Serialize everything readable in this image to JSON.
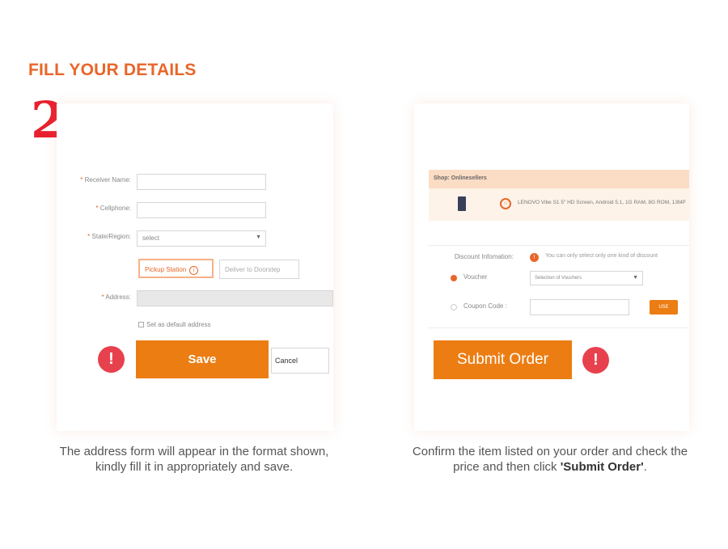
{
  "heading": "FILL YOUR DETAILS",
  "step_number": "2",
  "address_form": {
    "receiver_label": "Receiver Name:",
    "cellphone_label": "Cellphone:",
    "state_label": "State/Region:",
    "state_value": "select",
    "pickup_label": "Pickup Station",
    "pickup_info_icon": "i",
    "deliver_label": "Deliver to Doorstep",
    "address_label": "Address:",
    "default_checkbox_label": "Set as default address",
    "save_label": "Save",
    "cancel_label": "Cancel",
    "alert_symbol": "!"
  },
  "order": {
    "shop_label": "Shop: Onlinesellers",
    "item_icon": "○",
    "item_text": "LENOVO Vibe S1 5\" HD Screen, Android 5.1, 1G RAM, 8G ROM, 13MP",
    "discount_label": "Discount Infomation:",
    "discount_info_icon": "!",
    "discount_note": "You can only select only one kind of discount",
    "voucher_label": "Voucher",
    "voucher_value": "Selection of Vouchers",
    "coupon_label": "Coupon Code :",
    "use_label": "USE",
    "submit_label": "Submit Order",
    "alert_symbol": "!"
  },
  "captions": {
    "left_line1": "The address form will appear in the format shown,",
    "left_line2": "kindly fill it in appropriately and save.",
    "right_line1": "Confirm the item listed on your order and check the",
    "right_line2_prefix": "price and then click ",
    "right_line2_bold": "'Submit Order'",
    "right_line2_suffix": "."
  },
  "colors": {
    "accent": "#ec7d13",
    "heading": "#e8662a",
    "alert": "#e8414e",
    "step": "#e8202e"
  }
}
